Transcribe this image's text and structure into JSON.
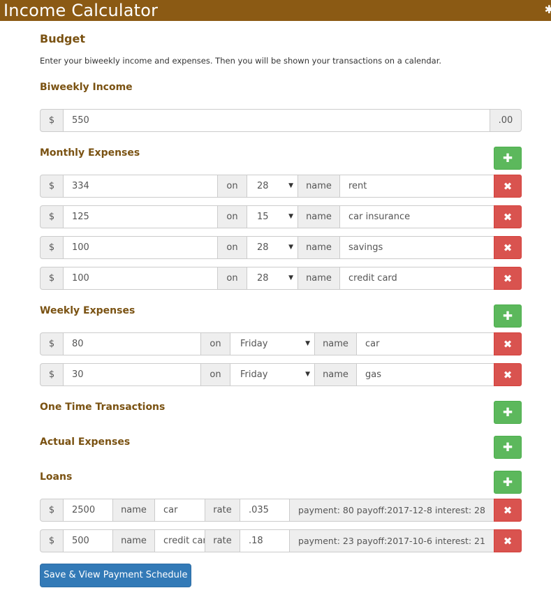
{
  "header": {
    "title": "Income Calculator"
  },
  "budget": {
    "heading": "Budget",
    "description": "Enter your biweekly income and expenses. Then you will be shown your transactions on a calendar."
  },
  "income": {
    "heading": "Biweekly Income",
    "currency": "$",
    "value": "550",
    "cents": ".00"
  },
  "monthly": {
    "heading": "Monthly Expenses",
    "on_label": "on",
    "name_label": "name",
    "currency": "$",
    "rows": [
      {
        "amount": "334",
        "day": "28",
        "name": "rent"
      },
      {
        "amount": "125",
        "day": "15",
        "name": "car insurance"
      },
      {
        "amount": "100",
        "day": "28",
        "name": "savings"
      },
      {
        "amount": "100",
        "day": "28",
        "name": "credit card"
      }
    ]
  },
  "weekly": {
    "heading": "Weekly Expenses",
    "on_label": "on",
    "name_label": "name",
    "currency": "$",
    "rows": [
      {
        "amount": "80",
        "day": "Friday",
        "name": "car"
      },
      {
        "amount": "30",
        "day": "Friday",
        "name": "gas"
      }
    ]
  },
  "one_time": {
    "heading": "One Time Transactions"
  },
  "actual": {
    "heading": "Actual Expenses"
  },
  "loans": {
    "heading": "Loans",
    "currency": "$",
    "name_label": "name",
    "rate_label": "rate",
    "rows": [
      {
        "amount": "2500",
        "name": "car",
        "rate": ".035",
        "summary": "payment: 80 payoff:2017-12-8 interest: 28"
      },
      {
        "amount": "500",
        "name": "credit card",
        "rate": ".18",
        "summary": "payment: 23 payoff:2017-10-6 interest: 21"
      }
    ]
  },
  "actions": {
    "save_label": "Save & View Payment Schedule"
  },
  "icons": {
    "add": "plus-icon",
    "remove": "times-icon",
    "settings": "gear-icon"
  },
  "colors": {
    "header": "#8b5a14",
    "heading": "#7a5212",
    "add": "#5cb85c",
    "remove": "#d9534f",
    "primary": "#337ab7"
  }
}
